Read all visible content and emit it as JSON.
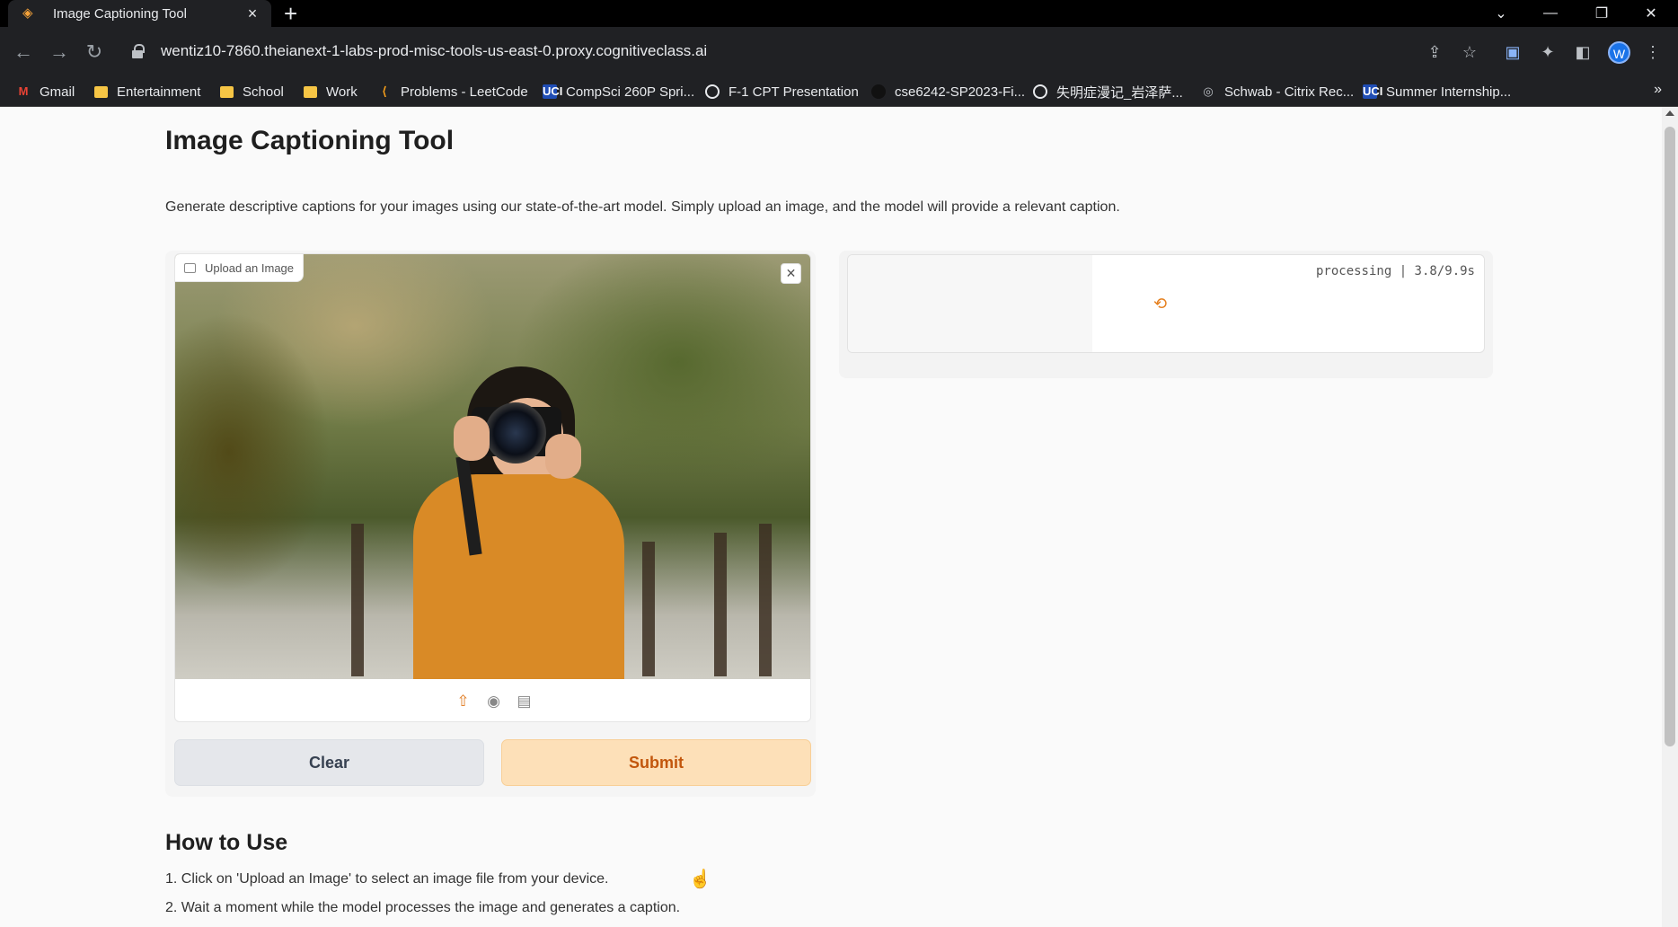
{
  "browser": {
    "tab_title": "Image Captioning Tool",
    "url": "wentiz10-7860.theianext-1-labs-prod-misc-tools-us-east-0.proxy.cognitiveclass.ai",
    "profile_initial": "W",
    "bookmarks": [
      {
        "label": "Gmail",
        "icon": "gmail-icon"
      },
      {
        "label": "Entertainment",
        "icon": "folder-icon"
      },
      {
        "label": "School",
        "icon": "folder-icon"
      },
      {
        "label": "Work",
        "icon": "folder-icon"
      },
      {
        "label": "Problems - LeetCode",
        "icon": "leetcode-icon"
      },
      {
        "label": "CompSci 260P Spri...",
        "icon": "uci-icon"
      },
      {
        "label": "F-1 CPT Presentation",
        "icon": "globe-icon"
      },
      {
        "label": "cse6242-SP2023-Fi...",
        "icon": "github-icon"
      },
      {
        "label": "失明症漫记_岩泽萨...",
        "icon": "globe-icon"
      },
      {
        "label": "Schwab - Citrix Rec...",
        "icon": "citrix-icon"
      },
      {
        "label": "Summer Internship...",
        "icon": "uci-icon"
      }
    ]
  },
  "page": {
    "title": "Image Captioning Tool",
    "description": "Generate descriptive captions for your images using our state-of-the-art model. Simply upload an image, and the model will provide a relevant caption.",
    "input": {
      "label": "Upload an Image",
      "clear_label": "Clear",
      "submit_label": "Submit"
    },
    "output": {
      "status": "processing | 3.8/9.9s"
    },
    "how_to": {
      "title": "How to Use",
      "steps": [
        "1. Click on 'Upload an Image' to select an image file from your device.",
        "2. Wait a moment while the model processes the image and generates a caption."
      ]
    }
  },
  "colors": {
    "accent": "#e07a1f",
    "submit_bg": "#fde0b8",
    "clear_bg": "#e5e7eb"
  }
}
